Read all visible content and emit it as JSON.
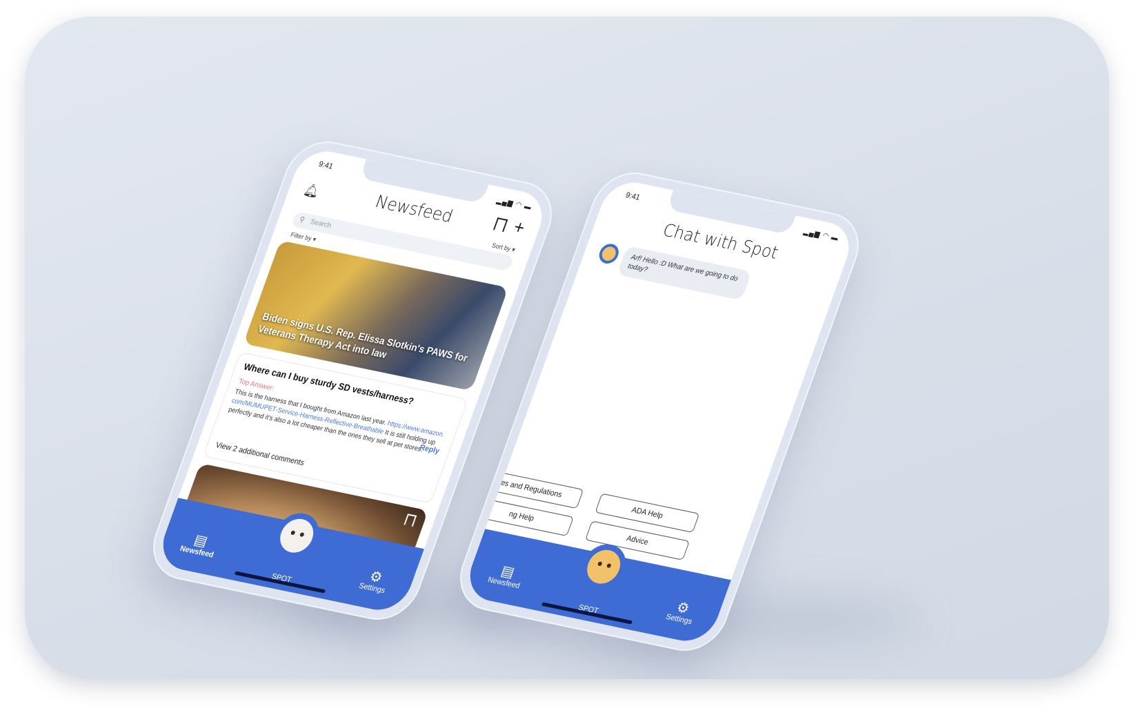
{
  "colors": {
    "accent": "#3f6bd4",
    "link": "#4a78e0",
    "top_answer": "#e07a86"
  },
  "newsfeed_phone": {
    "status_time": "9:41",
    "title": "Newsfeed",
    "icons": {
      "bell": "bell-icon",
      "bookmark": "bookmark-icon",
      "plus": "plus-icon",
      "search": "search-icon"
    },
    "sort_label": "Sort by",
    "search_placeholder": "Search",
    "filter_label": "Filter by",
    "article": {
      "headline": "Biden signs U.S. Rep. Elissa Slotkin's PAWS for Veterans Therapy Act into law"
    },
    "qa": {
      "question": "Where can I buy sturdy SD vests/harness?",
      "top_answer_label": "Top Answer:",
      "answer_text_1": "This is the harness that I bought from Amazon last year.",
      "answer_link": "https://www.amazon.com/MUMUPET-Service-Harness-Reflective-Breathable",
      "answer_text_2": "It is still holding up perfectly and it's also a lot cheaper than the ones they sell at pet stores.",
      "reply_label": "Reply",
      "view_more": "View 2 additional comments"
    },
    "tabs": {
      "newsfeed": "Newsfeed",
      "spot": "SPOT",
      "settings": "Settings"
    }
  },
  "chat_phone": {
    "status_time": "9:41",
    "title": "Chat with Spot",
    "message": "Arf! Hello :D What are we going to do today?",
    "quick_replies": {
      "rules": "es and Regulations",
      "training": "ng Help",
      "ada": "ADA Help",
      "advice": "Advice"
    },
    "tabs": {
      "newsfeed": "Newsfeed",
      "spot": "SPOT",
      "settings": "Settings"
    }
  }
}
